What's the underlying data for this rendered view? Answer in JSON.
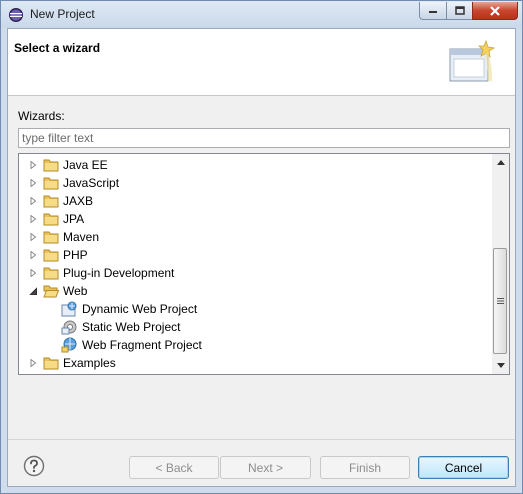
{
  "window": {
    "title": "New Project"
  },
  "header": {
    "title": "Select a wizard"
  },
  "wizards": {
    "label": "Wizards:",
    "filter_placeholder": "type filter text",
    "filter_value": ""
  },
  "tree": {
    "items": [
      {
        "label": "Java EE",
        "level": 0,
        "expanded": false,
        "icon": "folder-icon"
      },
      {
        "label": "JavaScript",
        "level": 0,
        "expanded": false,
        "icon": "folder-icon"
      },
      {
        "label": "JAXB",
        "level": 0,
        "expanded": false,
        "icon": "folder-icon"
      },
      {
        "label": "JPA",
        "level": 0,
        "expanded": false,
        "icon": "folder-icon"
      },
      {
        "label": "Maven",
        "level": 0,
        "expanded": false,
        "icon": "folder-icon"
      },
      {
        "label": "PHP",
        "level": 0,
        "expanded": false,
        "icon": "folder-icon"
      },
      {
        "label": "Plug-in Development",
        "level": 0,
        "expanded": false,
        "icon": "folder-icon"
      },
      {
        "label": "Web",
        "level": 0,
        "expanded": true,
        "icon": "folder-open-icon"
      },
      {
        "label": "Dynamic Web Project",
        "level": 1,
        "icon": "web-project-icon"
      },
      {
        "label": "Static Web Project",
        "level": 1,
        "icon": "static-web-icon"
      },
      {
        "label": "Web Fragment Project",
        "level": 1,
        "icon": "web-fragment-icon"
      },
      {
        "label": "Examples",
        "level": 0,
        "expanded": false,
        "icon": "folder-icon"
      }
    ]
  },
  "buttons": {
    "back": "< Back",
    "next": "Next >",
    "finish": "Finish",
    "cancel": "Cancel"
  },
  "colors": {
    "folder": "#e8c25a",
    "accent": "#3c7fb1",
    "close": "#c9452d"
  }
}
